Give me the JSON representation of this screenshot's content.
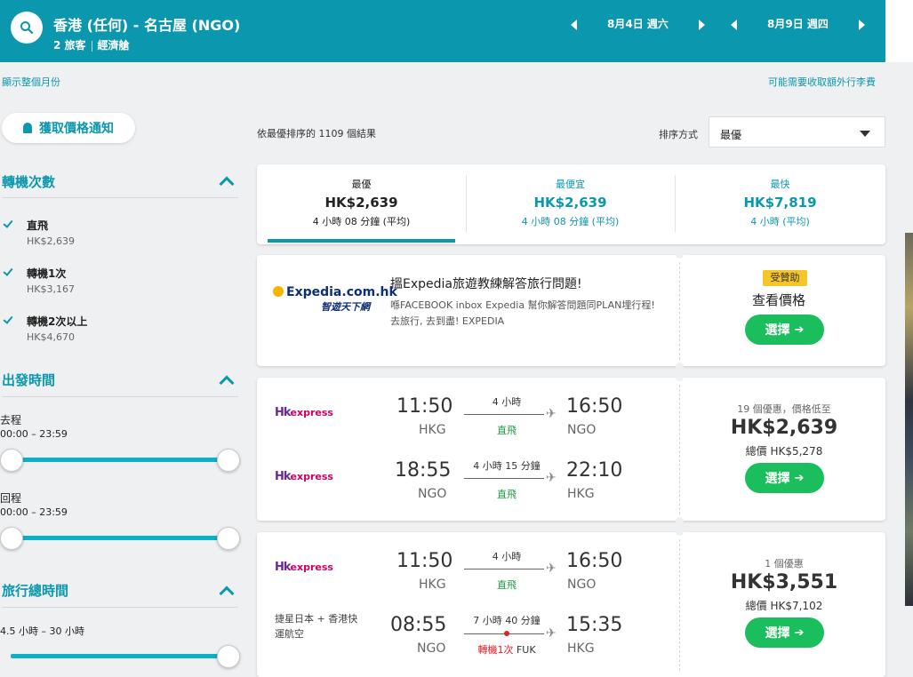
{
  "header": {
    "route": "香港 (任何) - 名古屋 (NGO)",
    "travelers": "2 旅客",
    "cabin": "經濟艙",
    "depart_date": "8月4日 週六",
    "return_date": "8月9日 週四"
  },
  "links": {
    "show_month": "顯示整個月份",
    "bag_fees": "可能需要收取額外行李費"
  },
  "sidebar": {
    "price_alert": "獲取價格通知",
    "stops": {
      "title": "轉機次數",
      "options": [
        {
          "label": "直飛",
          "price": "HK$2,639"
        },
        {
          "label": "轉機1次",
          "price": "HK$3,167"
        },
        {
          "label": "轉機2次以上",
          "price": "HK$4,670"
        }
      ]
    },
    "departure": {
      "title": "出發時間",
      "outbound_label": "去程",
      "outbound_range": "00:00 – 23:59",
      "return_label": "回程",
      "return_range": "00:00 – 23:59"
    },
    "duration": {
      "title": "旅行總時間",
      "range": "4.5 小時 – 30 小時"
    }
  },
  "results": {
    "count_text": "依最優排序的 1109 個結果",
    "sort_label": "排序方式",
    "sort_value": "最優",
    "tabs": [
      {
        "title": "最優",
        "price": "HK$2,639",
        "duration": "4 小時 08 分鐘 (平均)"
      },
      {
        "title": "最便宜",
        "price": "HK$2,639",
        "duration": "4 小時 08 分鐘 (平均)"
      },
      {
        "title": "最快",
        "price": "HK$7,819",
        "duration": "4 小時 (平均)"
      }
    ]
  },
  "ad": {
    "logo": "Expedia.com.hk",
    "logo_sub": "智遊天下網",
    "title": "搵Expedia旅遊教練解答旅行問題!",
    "desc": "喺FACEBOOK inbox Expedia 幫你解答問題同PLAN埋行程! 去旅行, 去到盡! EXPEDIA",
    "badge": "受贊助",
    "cta_title": "查看價格",
    "button": "選擇"
  },
  "flights": [
    {
      "legs": [
        {
          "airline": "HKexpress",
          "dep_time": "11:50",
          "dep_ap": "HKG",
          "duration": "4 小時",
          "stops": "直飛",
          "arr_time": "16:50",
          "arr_ap": "NGO"
        },
        {
          "airline": "HKexpress",
          "dep_time": "18:55",
          "dep_ap": "NGO",
          "duration": "4 小時 15 分鐘",
          "stops": "直飛",
          "arr_time": "22:10",
          "arr_ap": "HKG"
        }
      ],
      "deals": "19 個優惠，價格低至",
      "price": "HK$2,639",
      "total": "總價 HK$5,278",
      "button": "選擇"
    },
    {
      "legs": [
        {
          "airline": "HKexpress",
          "dep_time": "11:50",
          "dep_ap": "HKG",
          "duration": "4 小時",
          "stops": "直飛",
          "arr_time": "16:50",
          "arr_ap": "NGO"
        },
        {
          "airline": "捷星日本 + 香港快運航空",
          "dep_time": "08:55",
          "dep_ap": "NGO",
          "duration": "7 小時 40 分鐘",
          "stops": "轉機1次",
          "stop_ap": "FUK",
          "arr_time": "15:35",
          "arr_ap": "HKG"
        }
      ],
      "deals": "1 個優惠",
      "price": "HK$3,551",
      "total": "總價 HK$7,102",
      "button": "選擇"
    }
  ],
  "colors": {
    "brand": "#0b97ad",
    "select_button": "#1bbe5d",
    "sponsor_badge": "#f6c528",
    "direct": "#1a9c3c",
    "stop": "#e0202a"
  }
}
